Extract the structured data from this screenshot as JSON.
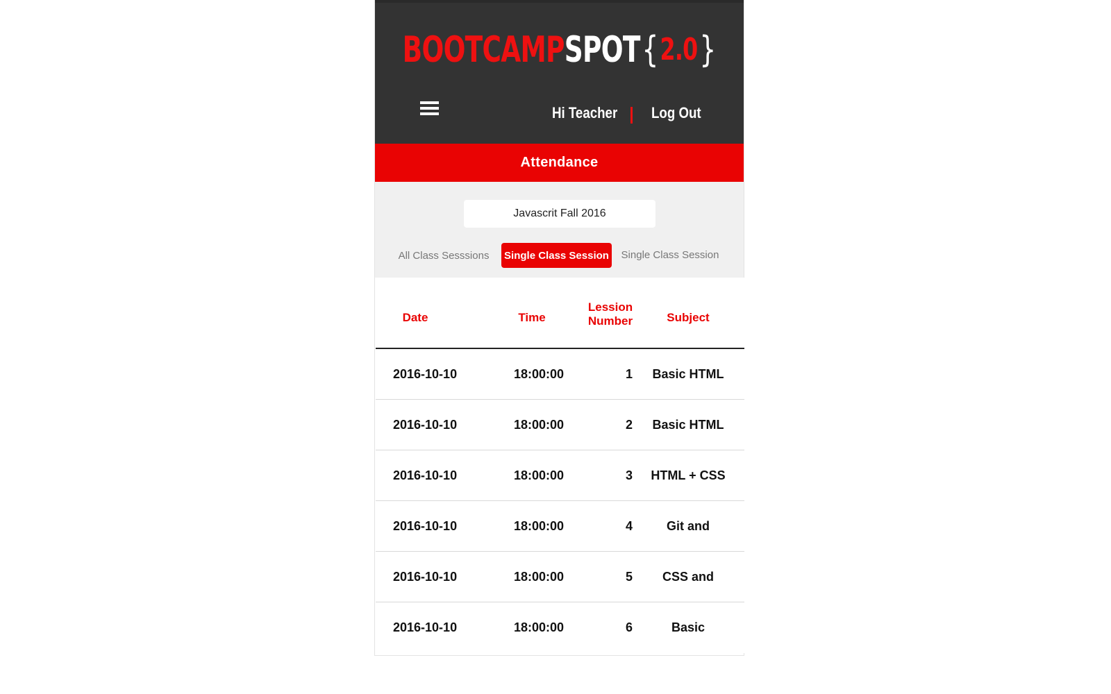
{
  "header": {
    "logo": {
      "part1": "BOOTCAMP",
      "part2": "SPOT",
      "open_brace": "{",
      "version": "2.0",
      "close_brace": "}"
    },
    "greeting": "Hi Teacher",
    "logout_label": "Log Out",
    "menu_icon": "hamburger-menu-icon"
  },
  "page": {
    "title": "Attendance"
  },
  "course_select": {
    "value": "Javascrit Fall 2016"
  },
  "tabs": [
    {
      "label": "All Class Sesssions",
      "active": false
    },
    {
      "label": "Single Class Session",
      "active": true
    },
    {
      "label": "Single Class Session",
      "active": false
    }
  ],
  "table": {
    "headers": {
      "date": "Date",
      "time": "Time",
      "lesson_line1": "Lession",
      "lesson_line2": "Number",
      "subject": "Subject"
    },
    "rows": [
      {
        "date": "2016-10-10",
        "time": "18:00:00",
        "lesson": "1",
        "subject": "Basic HTML"
      },
      {
        "date": "2016-10-10",
        "time": "18:00:00",
        "lesson": "2",
        "subject": "Basic HTML"
      },
      {
        "date": "2016-10-10",
        "time": "18:00:00",
        "lesson": "3",
        "subject": "HTML + CSS"
      },
      {
        "date": "2016-10-10",
        "time": "18:00:00",
        "lesson": "4",
        "subject": "Git and"
      },
      {
        "date": "2016-10-10",
        "time": "18:00:00",
        "lesson": "5",
        "subject": "CSS and"
      },
      {
        "date": "2016-10-10",
        "time": "18:00:00",
        "lesson": "6",
        "subject": "Basic"
      }
    ]
  },
  "colors": {
    "header_bg": "#333333",
    "accent_red": "#e90303",
    "controls_bg": "#f0f0f0"
  }
}
